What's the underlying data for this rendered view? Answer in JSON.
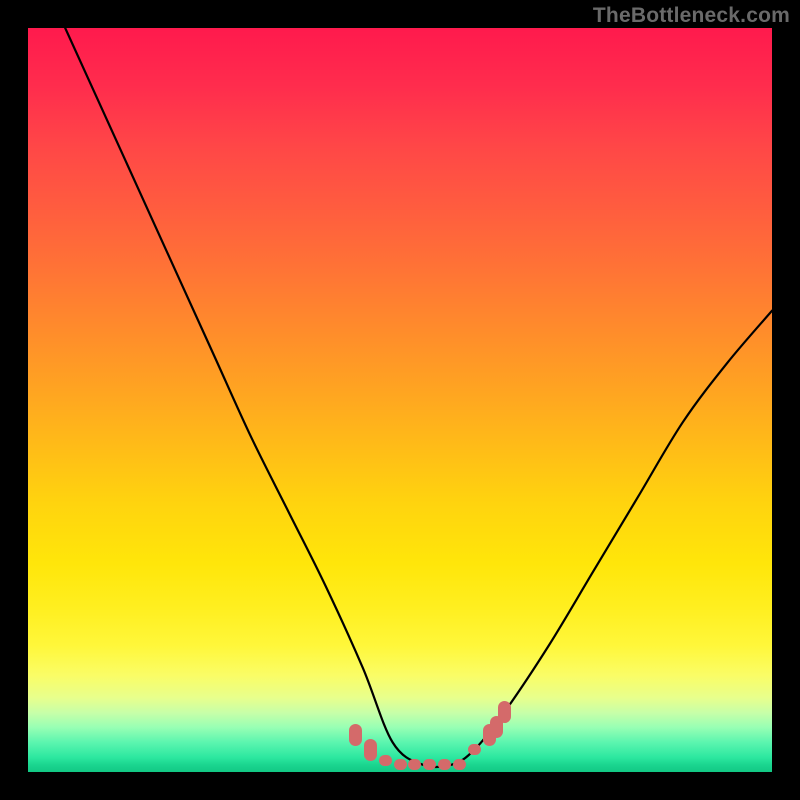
{
  "watermark": "TheBottleneck.com",
  "chart_data": {
    "type": "line",
    "title": "",
    "xlabel": "",
    "ylabel": "",
    "xlim": [
      0,
      100
    ],
    "ylim": [
      0,
      100
    ],
    "grid": false,
    "legend": false,
    "annotations": [],
    "series": [
      {
        "name": "bottleneck-curve",
        "color": "#000000",
        "x": [
          5,
          10,
          15,
          20,
          25,
          30,
          35,
          40,
          45,
          49,
          53,
          57,
          60,
          64,
          70,
          76,
          82,
          88,
          94,
          100
        ],
        "values": [
          100,
          89,
          78,
          67,
          56,
          45,
          35,
          25,
          14,
          4,
          1,
          1,
          3,
          8,
          17,
          27,
          37,
          47,
          55,
          62
        ]
      }
    ],
    "markers": {
      "name": "trough-markers",
      "color": "#d46a6a",
      "x": [
        44,
        46,
        48,
        50,
        52,
        54,
        56,
        58,
        60,
        62,
        63,
        64
      ],
      "y": [
        5,
        3,
        1.5,
        1,
        1,
        1,
        1,
        1,
        3,
        5,
        6,
        8
      ]
    },
    "gradient_stops": [
      {
        "pos": 0,
        "color": "#ff1a4d"
      },
      {
        "pos": 50,
        "color": "#ffbb18"
      },
      {
        "pos": 85,
        "color": "#fff73a"
      },
      {
        "pos": 100,
        "color": "#12c884"
      }
    ]
  }
}
